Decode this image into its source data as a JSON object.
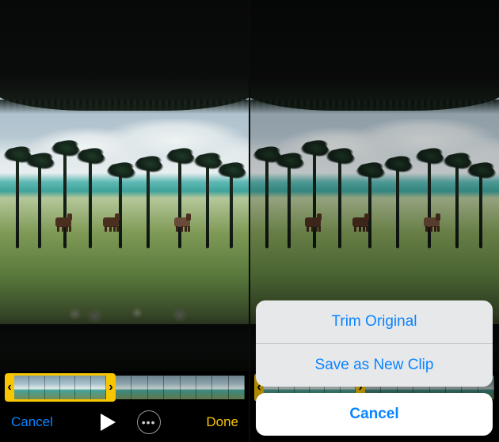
{
  "left": {
    "toolbar": {
      "cancel": "Cancel",
      "done": "Done"
    },
    "trim": {
      "left_glyph": "‹",
      "right_glyph": "›"
    }
  },
  "right": {
    "sheet": {
      "trim_original": "Trim Original",
      "save_new": "Save as New Clip",
      "cancel": "Cancel"
    }
  },
  "colors": {
    "ios_blue": "#0a84ff",
    "trim_yellow": "#f7c600"
  }
}
